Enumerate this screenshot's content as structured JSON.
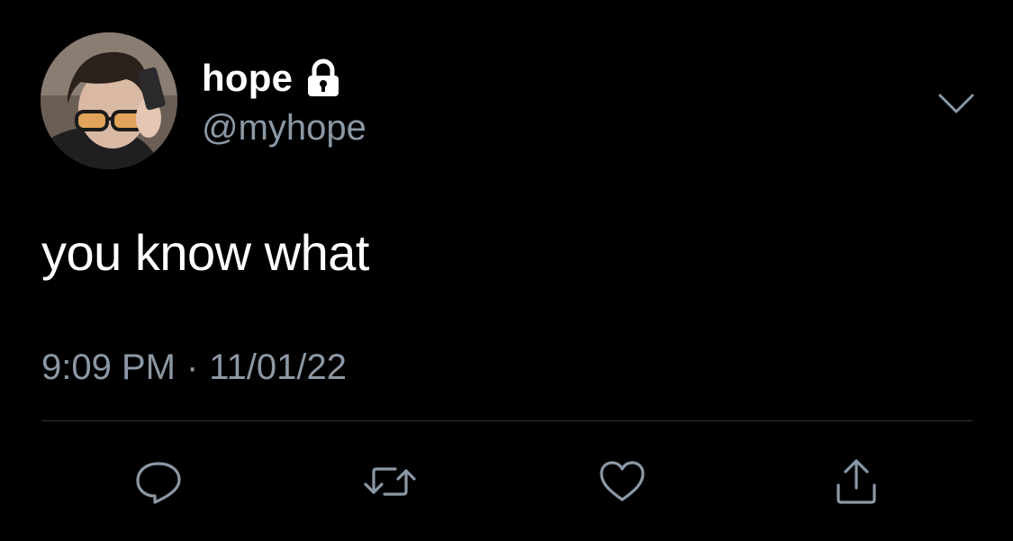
{
  "tweet": {
    "author": {
      "display_name": "hope",
      "handle": "@myhope",
      "protected_icon": "lock-icon",
      "avatar_icon": "profile-photo"
    },
    "text": "you know what",
    "time": "9:09 PM",
    "separator": "·",
    "date": "11/01/22",
    "menu_icon": "chevron-down-icon"
  },
  "actions": [
    {
      "icon": "reply-icon",
      "name": "reply"
    },
    {
      "icon": "retweet-icon",
      "name": "retweet"
    },
    {
      "icon": "like-icon",
      "name": "like"
    },
    {
      "icon": "share-icon",
      "name": "share"
    }
  ],
  "colors": {
    "background": "#000000",
    "primary_text": "#ffffff",
    "secondary_text": "#8b98a5",
    "divider": "#2f3336"
  }
}
